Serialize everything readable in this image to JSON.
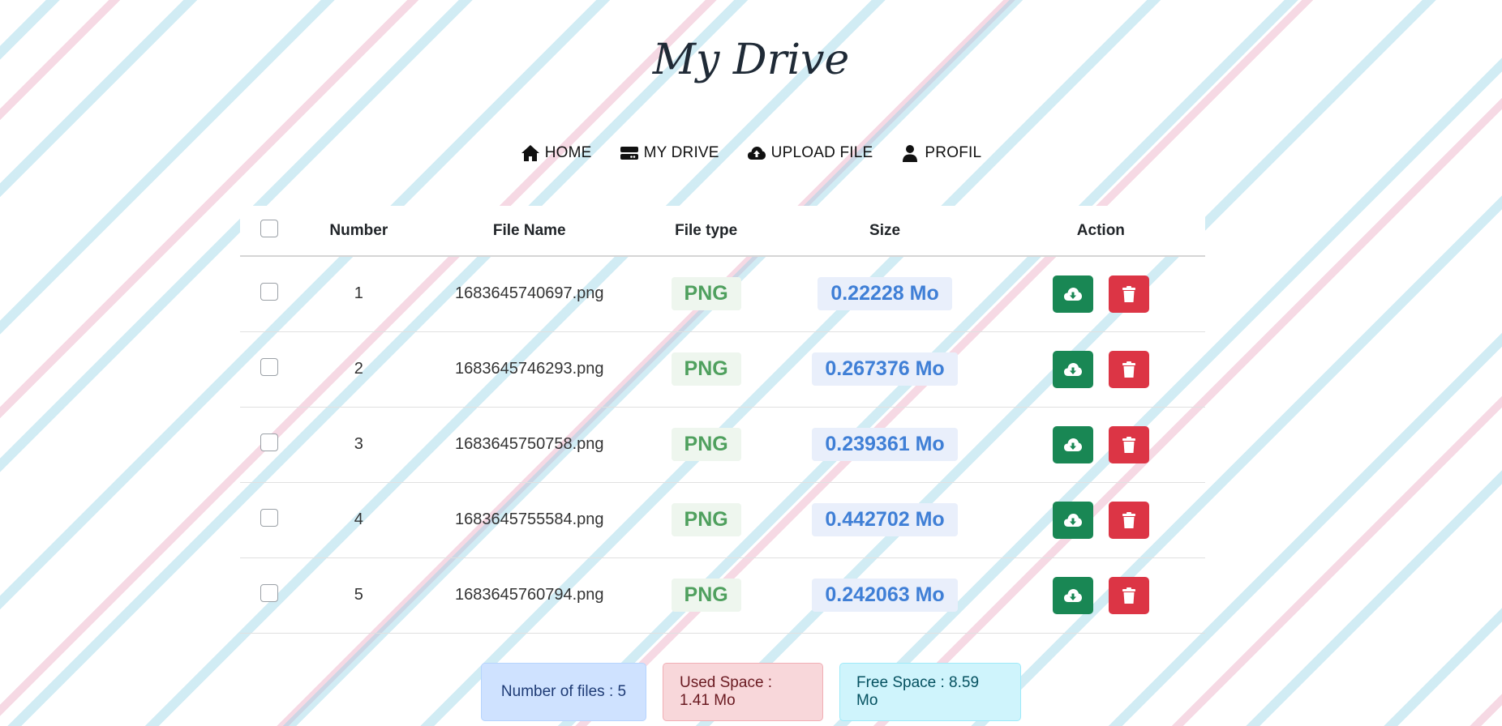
{
  "header": {
    "title": "My Drive"
  },
  "nav": {
    "items": [
      {
        "label": "HOME",
        "icon": "home-icon"
      },
      {
        "label": "MY DRIVE",
        "icon": "drive-icon"
      },
      {
        "label": "UPLOAD FILE",
        "icon": "cloud-upload-icon"
      },
      {
        "label": "PROFIL",
        "icon": "user-icon"
      }
    ]
  },
  "table": {
    "headers": {
      "number": "Number",
      "file_name": "File Name",
      "file_type": "File type",
      "size": "Size",
      "action": "Action"
    },
    "rows": [
      {
        "number": "1",
        "file_name": "1683645740697.png",
        "file_type": "PNG",
        "size": "0.22228 Mo"
      },
      {
        "number": "2",
        "file_name": "1683645746293.png",
        "file_type": "PNG",
        "size": "0.267376 Mo"
      },
      {
        "number": "3",
        "file_name": "1683645750758.png",
        "file_type": "PNG",
        "size": "0.239361 Mo"
      },
      {
        "number": "4",
        "file_name": "1683645755584.png",
        "file_type": "PNG",
        "size": "0.442702 Mo"
      },
      {
        "number": "5",
        "file_name": "1683645760794.png",
        "file_type": "PNG",
        "size": "0.242063 Mo"
      }
    ],
    "action_icons": {
      "download": "cloud-download-icon",
      "delete": "trash-icon"
    }
  },
  "stats": {
    "files": "Number of files : 5",
    "used": "Used Space : 1.41 Mo",
    "free": "Free Space : 8.59 Mo"
  },
  "colors": {
    "download_button": "#198754",
    "delete_button": "#dc3545",
    "type_text": "#4fa05e",
    "size_text": "#3f7fd6",
    "stripe_blue": "#92d2e6",
    "stripe_pink": "#e9a5be"
  }
}
